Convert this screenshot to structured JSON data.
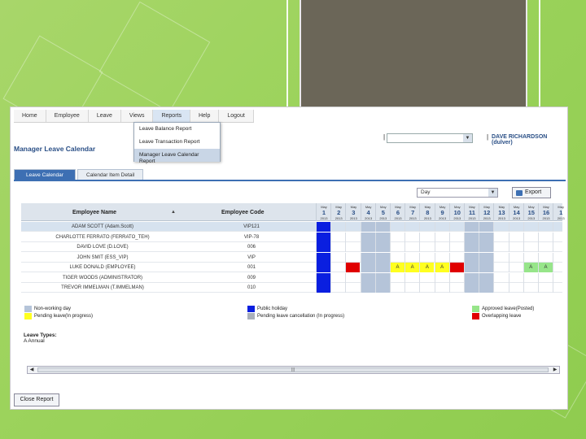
{
  "menu": {
    "items": [
      {
        "label": "Home"
      },
      {
        "label": "Employee"
      },
      {
        "label": "Leave"
      },
      {
        "label": "Views"
      },
      {
        "label": "Reports"
      },
      {
        "label": "Help"
      },
      {
        "label": "Logout"
      }
    ],
    "dropdown": [
      "Leave Balance Report",
      "Leave Transaction Report",
      "Manager Leave Calendar Report"
    ]
  },
  "page": {
    "title": "Manager Leave Calendar",
    "pipe_left": "|",
    "pipe_right": "|",
    "user": "DAVE RICHARDSON (dulver)"
  },
  "tabs": [
    "Leave Calendar",
    "Calendar Item Detail"
  ],
  "controls": {
    "period_value": "Day",
    "export_label": "Export",
    "close_label": "Close Report"
  },
  "grid": {
    "col_name": "Employee Name",
    "col_code": "Employee Code",
    "sort_icon": "▲",
    "day_month": "May",
    "day_year": "2013",
    "days": [
      "1",
      "2",
      "3",
      "4",
      "5",
      "6",
      "7",
      "8",
      "9",
      "10",
      "11",
      "12",
      "13",
      "14",
      "15",
      "16",
      "1"
    ],
    "rows": [
      {
        "name": "ADAM SCOTT (Adam.Scott)",
        "code": "VIP121",
        "cells": [
          "ph",
          "",
          "",
          "nw",
          "nw",
          "",
          "",
          "",
          "",
          "",
          "nw",
          "nw",
          "",
          "",
          "",
          "",
          ""
        ]
      },
      {
        "name": "CHARLOTTE FERRATO (FERRATO_TEH)",
        "code": "VIP-78",
        "cells": [
          "ph",
          "",
          "",
          "nw",
          "nw",
          "",
          "",
          "",
          "",
          "",
          "nw",
          "nw",
          "",
          "",
          "",
          "",
          ""
        ]
      },
      {
        "name": "DAVID LOVE (D.LOVE)",
        "code": "006",
        "cells": [
          "ph",
          "",
          "",
          "nw",
          "nw",
          "",
          "",
          "",
          "",
          "",
          "nw",
          "nw",
          "",
          "",
          "",
          "",
          ""
        ]
      },
      {
        "name": "JOHN SMIT (ESS_VIP)",
        "code": "VIP",
        "cells": [
          "ph",
          "",
          "",
          "nw",
          "nw",
          "",
          "",
          "",
          "",
          "",
          "nw",
          "nw",
          "",
          "",
          "",
          "",
          ""
        ]
      },
      {
        "name": "LUKE DONALD (EMPLOYEE)",
        "code": "001",
        "cells": [
          "ph",
          "",
          "ov",
          "nw",
          "nw",
          "pl",
          "pl",
          "pl",
          "pl",
          "ov",
          "nw",
          "nw",
          "",
          "",
          "ap",
          "ap",
          ""
        ]
      },
      {
        "name": "TIGER WOODS (ADMINISTRATOR)",
        "code": "009",
        "cells": [
          "ph",
          "",
          "",
          "nw",
          "nw",
          "",
          "",
          "",
          "",
          "",
          "nw",
          "nw",
          "",
          "",
          "",
          "",
          ""
        ]
      },
      {
        "name": "TREVOR IMMELMAN (T.IMMELMAN)",
        "code": "010",
        "cells": [
          "ph",
          "",
          "",
          "nw",
          "nw",
          "",
          "",
          "",
          "",
          "",
          "nw",
          "nw",
          "",
          "",
          "",
          "",
          ""
        ]
      }
    ],
    "leave_marker": "A"
  },
  "legend": {
    "non_working": "Non-working day",
    "pending": "Pending leave(In progress)",
    "public_holiday": "Public holiday",
    "pending_cancel": "Pending leave cancellation (In progress)",
    "approved": "Approved leave(Posted)",
    "overlapping": "Overlapping leave"
  },
  "leave_types": {
    "title": "Leave Types:",
    "item": "A Annual"
  },
  "scroll": {
    "left": "◀",
    "right": "▶",
    "grip": "|||"
  },
  "colors": {
    "non_working": "#b5c4d9",
    "public_holiday": "#0a1fe0",
    "pending": "#ffff20",
    "overlapping": "#e00000",
    "approved": "#97e58a",
    "pending_cancel": "#aab0bb",
    "accent": "#3d6fb3"
  }
}
